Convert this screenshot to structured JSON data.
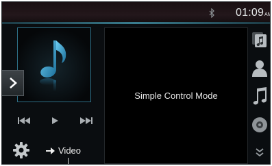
{
  "status_bar": {
    "time": "01:09",
    "ampm": "AM",
    "bluetooth_icon": "bluetooth-icon"
  },
  "album_art": {
    "icon": "music-note-icon"
  },
  "expand_tab": {
    "icon": "chevron-right-icon"
  },
  "playback_controls": [
    {
      "name": "previous-track-button",
      "icon": "skip-back-icon"
    },
    {
      "name": "play-button",
      "icon": "play-icon"
    },
    {
      "name": "next-track-button",
      "icon": "skip-forward-icon"
    }
  ],
  "main_panel": {
    "message": "Simple Control Mode"
  },
  "side_menu": [
    {
      "name": "playlist-button",
      "icon": "playlist-icon"
    },
    {
      "name": "artist-button",
      "icon": "person-icon"
    },
    {
      "name": "songs-button",
      "icon": "music-note-icon"
    },
    {
      "name": "disc-button",
      "icon": "disc-icon"
    },
    {
      "name": "more-button",
      "icon": "double-chevron-down-icon"
    }
  ],
  "bottom_bar": {
    "settings_icon": "gear-icon",
    "source_switch_label": "Video"
  },
  "colors": {
    "accent": "#2e6f86",
    "note_blue": "#3aa8d8",
    "text": "#e8e8e8"
  }
}
